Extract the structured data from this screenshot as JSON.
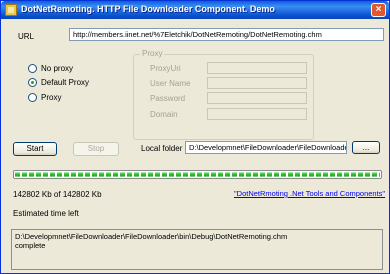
{
  "window": {
    "title": "DotNetRemoting. HTTP File Downloader Component. Demo",
    "close_glyph": "×"
  },
  "url": {
    "label": "URL",
    "value": "http://members.iinet.net/%7Eletchik/DotNetRemoting/DotNetRemoting.chm"
  },
  "proxy_mode": {
    "options": [
      "No proxy",
      "Default Proxy",
      "Proxy"
    ],
    "selected": "Default Proxy"
  },
  "proxy": {
    "group_title": "Proxy",
    "fields": [
      {
        "label": "ProxyUri",
        "value": ""
      },
      {
        "label": "User Name",
        "value": ""
      },
      {
        "label": "Password",
        "value": ""
      },
      {
        "label": "Domain",
        "value": ""
      }
    ]
  },
  "buttons": {
    "start": "Start",
    "stop": "Stop",
    "browse": "..."
  },
  "local_folder": {
    "label": "Local folder",
    "value": "D:\\Developmnet\\FileDownloader\\FileDownloader\\bin"
  },
  "progress": {
    "fraction": 1.0,
    "color": "#2fc32f"
  },
  "status": {
    "bytes": "142802 Kb of 142802 Kb",
    "time_left": "Estimated time left",
    "link": "\"DotNetRmoting .Net Tools and Components\""
  },
  "log": {
    "lines": [
      "D:\\Developmnet\\FileDownloader\\FileDownloader\\bin\\Debug\\DotNetRemoting.chm",
      "complete"
    ]
  }
}
